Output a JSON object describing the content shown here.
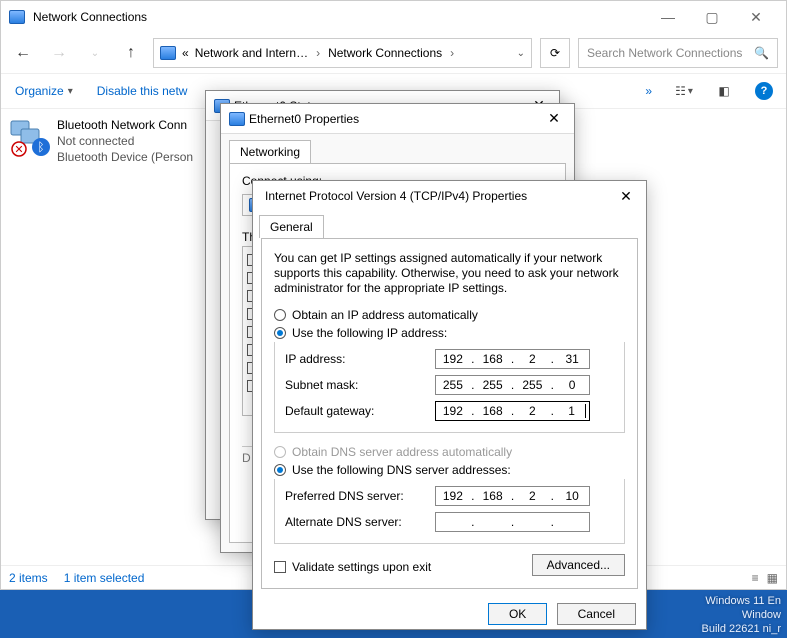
{
  "window": {
    "title": "Network Connections"
  },
  "nav": {
    "crumb_more": "«",
    "crumb1": "Network and Intern…",
    "crumb2": "Network Connections",
    "search_placeholder": "Search Network Connections"
  },
  "toolbar": {
    "organize": "Organize",
    "disable": "Disable this netw",
    "more": "»"
  },
  "device": {
    "name": "Bluetooth Network Conn",
    "status": "Not connected",
    "detail": "Bluetooth Device (Person"
  },
  "statusbar": {
    "items": "2 items",
    "selected": "1 item selected"
  },
  "dlg_status": {
    "title": "Ethernet0 Status"
  },
  "dlg_props": {
    "title": "Ethernet0 Properties",
    "tab": "Networking",
    "connect_using": "Connect using:",
    "items_label": "Th"
  },
  "dlg_ipv4": {
    "title": "Internet Protocol Version 4 (TCP/IPv4) Properties",
    "tab": "General",
    "intro": "You can get IP settings assigned automatically if your network supports this capability. Otherwise, you need to ask your network administrator for the appropriate IP settings.",
    "radio_ip_auto": "Obtain an IP address automatically",
    "radio_ip_manual": "Use the following IP address:",
    "label_ip": "IP address:",
    "label_mask": "Subnet mask:",
    "label_gw": "Default gateway:",
    "radio_dns_auto": "Obtain DNS server address automatically",
    "radio_dns_manual": "Use the following DNS server addresses:",
    "label_dns1": "Preferred DNS server:",
    "label_dns2": "Alternate DNS server:",
    "validate": "Validate settings upon exit",
    "advanced": "Advanced...",
    "ok": "OK",
    "cancel": "Cancel",
    "ip": {
      "a": "192",
      "b": "168",
      "c": "2",
      "d": "31"
    },
    "mask": {
      "a": "255",
      "b": "255",
      "c": "255",
      "d": "0"
    },
    "gw": {
      "a": "192",
      "b": "168",
      "c": "2",
      "d": "1"
    },
    "dns1": {
      "a": "192",
      "b": "168",
      "c": "2",
      "d": "10"
    },
    "dns2": {
      "a": "",
      "b": "",
      "c": "",
      "d": ""
    }
  },
  "watermark": {
    "l1": "Windows 11 En",
    "l2": "Window",
    "l3": "Build 22621 ni_r"
  }
}
